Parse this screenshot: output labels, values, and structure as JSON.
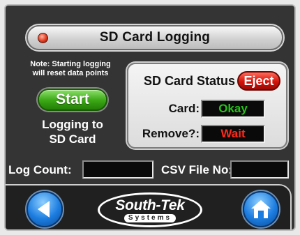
{
  "title_bar": {
    "title": "SD Card Logging"
  },
  "left_panel": {
    "note": "Note: Starting logging will reset data points",
    "start_label": "Start",
    "status_line1": "Logging to",
    "status_line2": "SD Card"
  },
  "status_panel": {
    "title": "SD Card Status",
    "eject_label": "Eject",
    "card_label": "Card:",
    "card_value": "Okay",
    "remove_label": "Remove?:",
    "remove_value": "Wait"
  },
  "counters": {
    "log_count_label": "Log Count:",
    "log_count_value": "",
    "csv_file_label": "CSV File No:",
    "csv_file_value": ""
  },
  "nav": {
    "back_icon": "back-arrow-icon",
    "home_icon": "home-icon",
    "logo_main": "South-Tek",
    "logo_sub": "Systems"
  },
  "colors": {
    "ok_text": "#27c21a",
    "wait_text": "#ff2a1a",
    "start_green": "#3aa614",
    "eject_red": "#d4120a",
    "nav_blue": "#1c7de0"
  }
}
